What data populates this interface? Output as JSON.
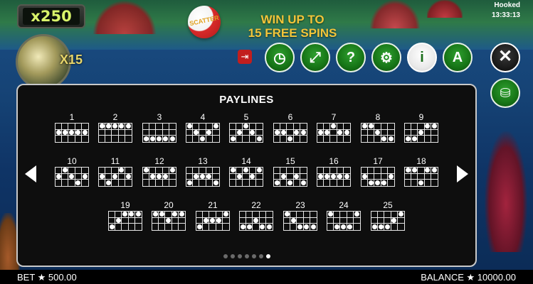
{
  "header": {
    "multiplier_meter": "x250",
    "dial_multiplier": "X15",
    "scatter_label": "SCATTER",
    "promo_line1": "WIN UP TO",
    "promo_line2": "15 FREE SPINS",
    "game_name": "Hooked",
    "clock": "13:33:13"
  },
  "toolbar": {
    "buttons": [
      {
        "name": "autoplay",
        "icon": "clock-icon",
        "glyph": "◷"
      },
      {
        "name": "fullscreen",
        "icon": "expand-icon",
        "glyph": "⤢"
      },
      {
        "name": "help",
        "icon": "question-icon",
        "glyph": "?"
      },
      {
        "name": "settings",
        "icon": "gear-icon",
        "glyph": "⚙"
      },
      {
        "name": "info",
        "icon": "info-icon",
        "glyph": "i"
      },
      {
        "name": "autospin",
        "icon": "auto-icon",
        "glyph": "A"
      }
    ],
    "exit_glyph": "⇥",
    "close_glyph": "✕",
    "coins_glyph": "⛁"
  },
  "panel": {
    "title": "PAYLINES",
    "pages": 7,
    "active_page": 6
  },
  "paylines": [
    {
      "n": "1",
      "rows": [
        1,
        1,
        1,
        1,
        1
      ]
    },
    {
      "n": "2",
      "rows": [
        0,
        0,
        0,
        0,
        0
      ]
    },
    {
      "n": "3",
      "rows": [
        2,
        2,
        2,
        2,
        2
      ]
    },
    {
      "n": "4",
      "rows": [
        0,
        1,
        2,
        1,
        0
      ]
    },
    {
      "n": "5",
      "rows": [
        2,
        1,
        0,
        1,
        2
      ]
    },
    {
      "n": "6",
      "rows": [
        1,
        1,
        2,
        1,
        1
      ]
    },
    {
      "n": "7",
      "rows": [
        1,
        1,
        0,
        1,
        1
      ]
    },
    {
      "n": "8",
      "rows": [
        0,
        0,
        1,
        2,
        2
      ]
    },
    {
      "n": "9",
      "rows": [
        2,
        2,
        1,
        0,
        0
      ]
    },
    {
      "n": "10",
      "rows": [
        1,
        0,
        1,
        2,
        1
      ]
    },
    {
      "n": "11",
      "rows": [
        1,
        2,
        1,
        0,
        1
      ]
    },
    {
      "n": "12",
      "rows": [
        0,
        1,
        1,
        1,
        0
      ]
    },
    {
      "n": "13",
      "rows": [
        2,
        1,
        1,
        1,
        2
      ]
    },
    {
      "n": "14",
      "rows": [
        0,
        1,
        0,
        1,
        0
      ]
    },
    {
      "n": "15",
      "rows": [
        2,
        1,
        2,
        1,
        2
      ]
    },
    {
      "n": "16",
      "rows": [
        1,
        1,
        1,
        1,
        1
      ]
    },
    {
      "n": "17",
      "rows": [
        1,
        2,
        2,
        2,
        1
      ]
    },
    {
      "n": "18",
      "rows": [
        0,
        0,
        2,
        0,
        0
      ]
    },
    {
      "n": "19",
      "rows": [
        2,
        1,
        0,
        0,
        0
      ]
    },
    {
      "n": "20",
      "rows": [
        0,
        0,
        1,
        0,
        0
      ]
    },
    {
      "n": "21",
      "rows": [
        2,
        1,
        1,
        1,
        0
      ]
    },
    {
      "n": "22",
      "rows": [
        2,
        2,
        1,
        2,
        2
      ]
    },
    {
      "n": "23",
      "rows": [
        0,
        1,
        2,
        2,
        2
      ]
    },
    {
      "n": "24",
      "rows": [
        0,
        2,
        2,
        2,
        0
      ]
    },
    {
      "n": "25",
      "rows": [
        2,
        2,
        2,
        1,
        0
      ]
    }
  ],
  "footer": {
    "bet": "BET ★ 500.00",
    "balance": "BALANCE ★ 10000.00"
  }
}
